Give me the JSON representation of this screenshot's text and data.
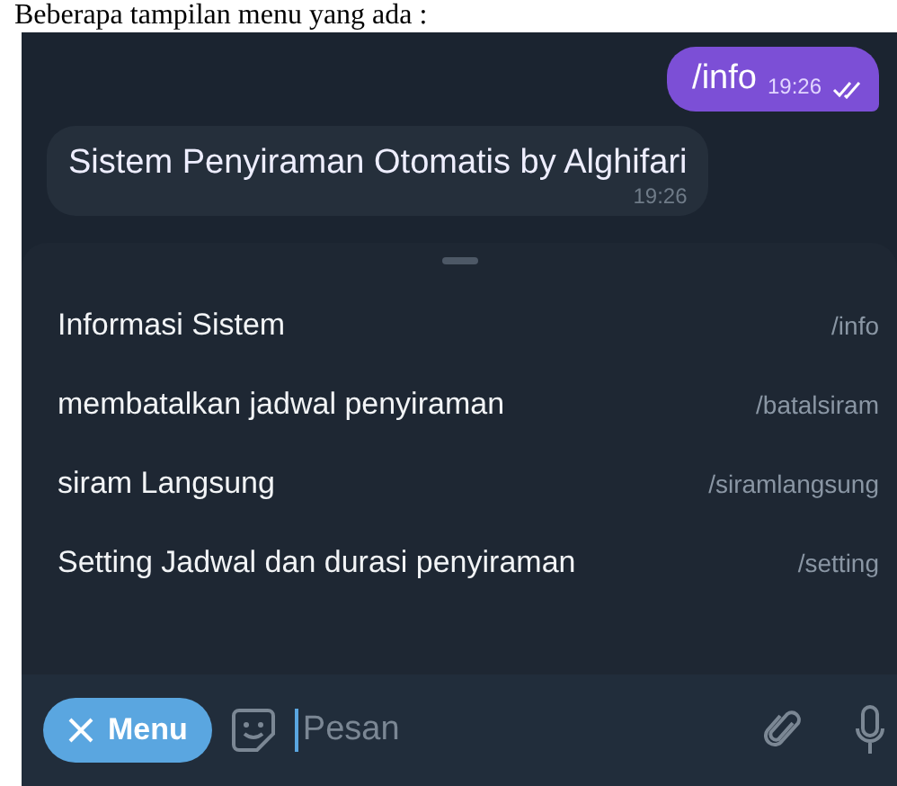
{
  "caption": "Beberapa tampilan menu yang ada :",
  "messages": [
    {
      "kind": "outgoing",
      "text": "/info",
      "time": "19:26",
      "read": true
    },
    {
      "kind": "incoming",
      "text": "Sistem Penyiraman Otomatis by Alghifari",
      "time": "19:26"
    }
  ],
  "commands": [
    {
      "description": "Informasi Sistem",
      "command": "/info"
    },
    {
      "description": "membatalkan jadwal penyiraman",
      "command": "/batalsiram"
    },
    {
      "description": "siram Langsung",
      "command": "/siramlangsung"
    },
    {
      "description": "Setting Jadwal dan durasi penyiraman",
      "command": "/setting"
    }
  ],
  "input": {
    "menu_label": "Menu",
    "placeholder": "Pesan"
  }
}
